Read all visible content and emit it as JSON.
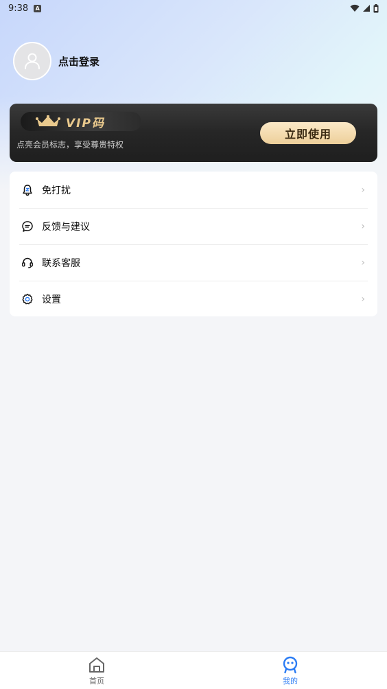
{
  "status": {
    "time": "9:38",
    "notification_glyph": "A"
  },
  "profile": {
    "login_text": "点击登录",
    "avatar_icon": "user-icon"
  },
  "vip": {
    "title": "VIP码",
    "subtitle": "点亮会员标志，享受尊贵特权",
    "button_label": "立即使用",
    "crown_color": "#e9c98d"
  },
  "menu": {
    "items": [
      {
        "label": "免打扰",
        "icon": "bell-off-icon"
      },
      {
        "label": "反馈与建议",
        "icon": "chat-icon"
      },
      {
        "label": "联系客服",
        "icon": "headset-icon"
      },
      {
        "label": "设置",
        "icon": "gear-icon"
      }
    ]
  },
  "tabs": [
    {
      "label": "首页",
      "icon": "home-icon",
      "active": false
    },
    {
      "label": "我的",
      "icon": "profile-face-icon",
      "active": true
    }
  ],
  "colors": {
    "accent": "#2b7cf4",
    "vip_button": "#f3d9a8"
  }
}
